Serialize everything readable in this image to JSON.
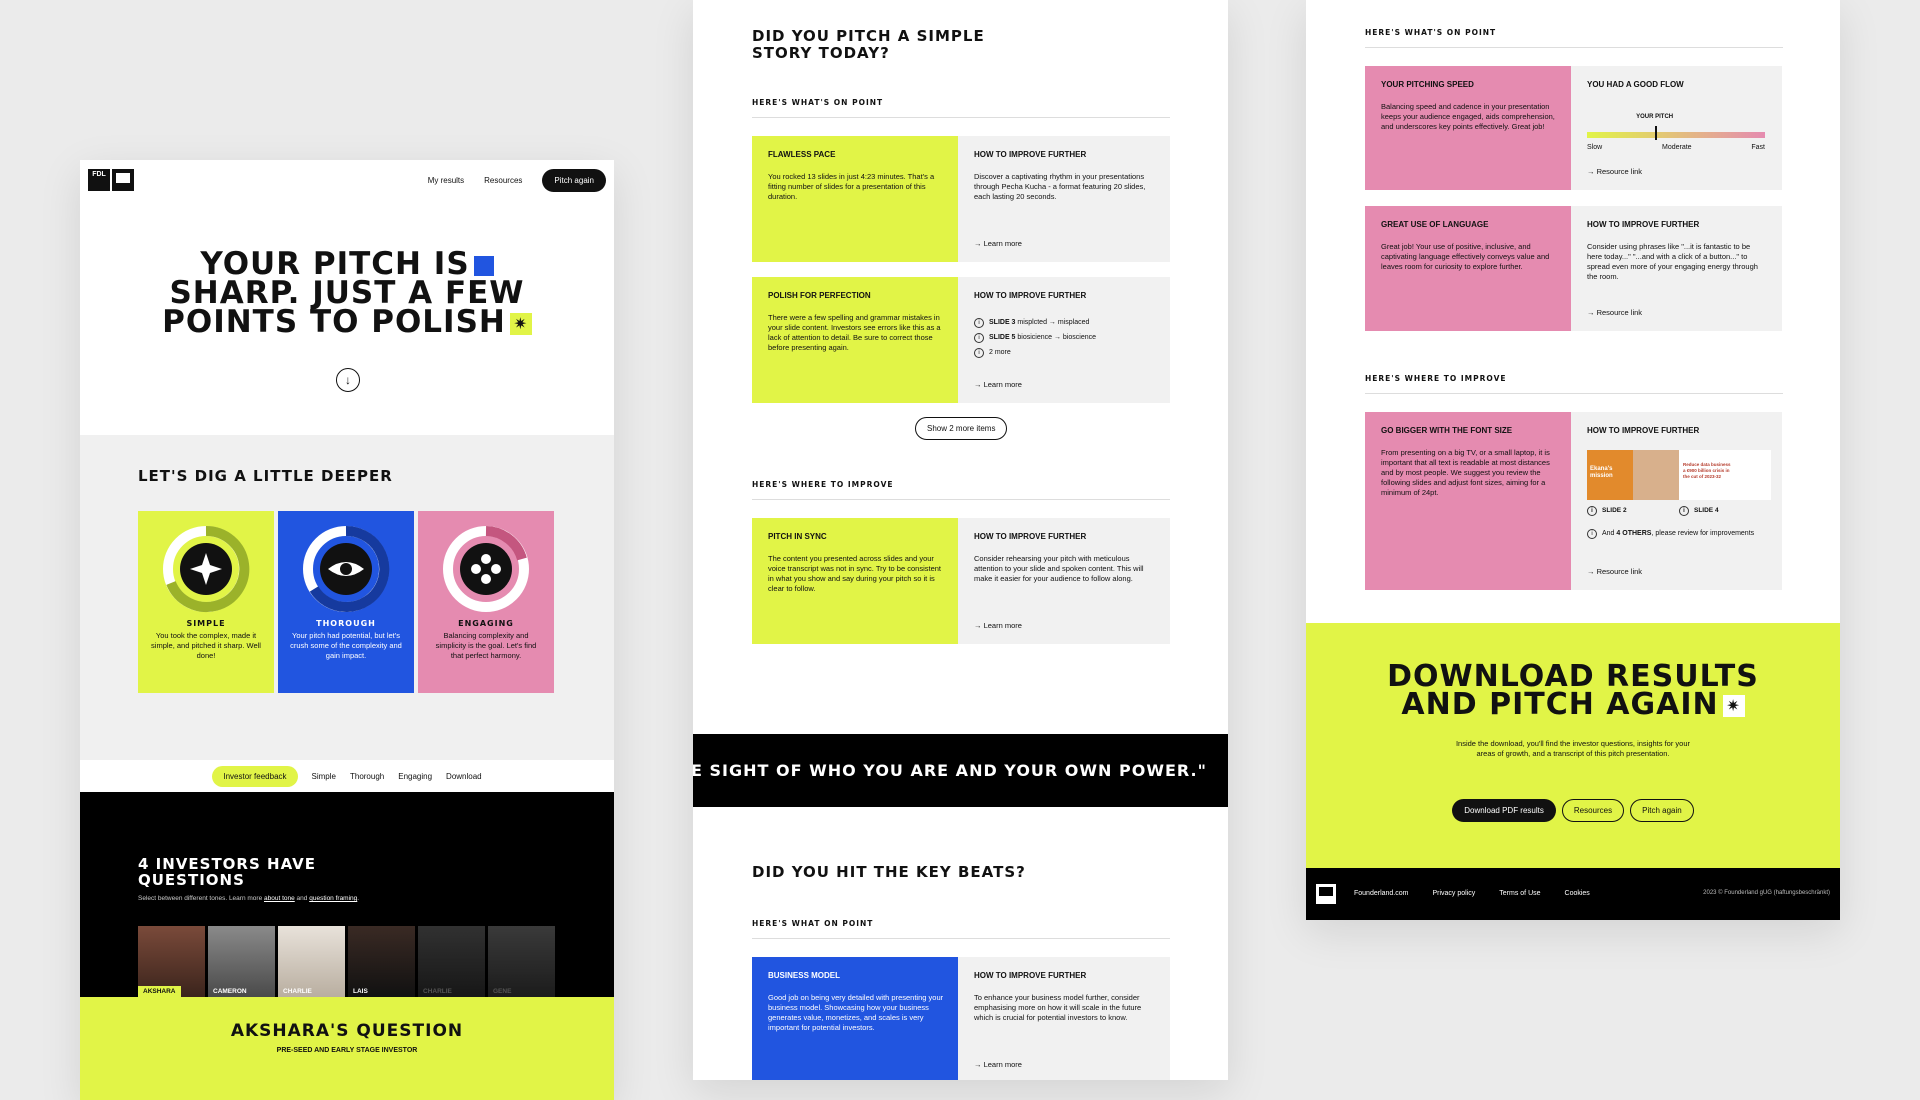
{
  "colors": {
    "lime": "#e1f447",
    "blue": "#2155e0",
    "pink": "#e58bb0",
    "black": "#000000",
    "bg": "#ebebeb"
  },
  "panel1": {
    "logo_text": "FDL",
    "nav": {
      "my_results": "My results",
      "resources": "Resources",
      "pitch_again": "Pitch again"
    },
    "hero": {
      "line1": "YOUR PITCH IS",
      "line2": "SHARP. JUST A FEW",
      "line3": "POINTS TO POLISH"
    },
    "scroll_icon": "arrow-down-icon",
    "dig_title": "LET'S DIG A LITTLE DEEPER",
    "cards": [
      {
        "title": "SIMPLE",
        "desc": "You took the complex, made it simple, and pitched it sharp. Well done!"
      },
      {
        "title": "THOROUGH",
        "desc": "Your pitch had potential, but let's crush some of the complexity and gain impact."
      },
      {
        "title": "ENGAGING",
        "desc": "Balancing complexity and simplicity is the goal. Let's find that perfect harmony."
      }
    ],
    "tabs": [
      "Investor feedback",
      "Simple",
      "Thorough",
      "Engaging",
      "Download"
    ],
    "investors_title_1": "4 INVESTORS HAVE",
    "investors_title_2": "QUESTIONS",
    "investors_sub_1": "Select between different tones. Learn more",
    "investors_sub_link1": "about tone",
    "investors_sub_2": "and",
    "investors_sub_link2": "question framing",
    "investors": [
      "AKSHARA",
      "CAMERON",
      "CHARLIE",
      "LAIS",
      "CHARLIE",
      "GENE"
    ],
    "question_title": "AKSHARA'S QUESTION",
    "question_sub": "PRE-SEED AND EARLY STAGE INVESTOR"
  },
  "panel2": {
    "title_1": "DID YOU PITCH A SIMPLE",
    "title_2": "STORY TODAY?",
    "on_point": "HERE'S WHAT'S ON POINT",
    "blocks": [
      {
        "title": "FLAWLESS PACE",
        "desc": "You rocked 13 slides in just 4:23 minutes. That's a fitting number of slides for a presentation of this duration.",
        "r_title": "HOW TO IMPROVE FURTHER",
        "r_desc": "Discover a captivating rhythm in your presentations through Pecha Kucha - a format featuring 20 slides, each lasting 20 seconds.",
        "link": "Learn more"
      },
      {
        "title": "POLISH FOR PERFECTION",
        "desc": "There were a few spelling and grammar mistakes in your slide content. Investors see errors like this as a lack of attention to detail. Be sure to correct those before presenting again.",
        "r_title": "HOW TO IMPROVE FURTHER",
        "link": "Learn more"
      }
    ],
    "slide_fixes": [
      {
        "slide": "SLIDE 3",
        "text": "misplcted → misplaced"
      },
      {
        "slide": "SLIDE 5",
        "text": "biosicience → bioscience"
      },
      {
        "slide": "",
        "text": "2 more"
      }
    ],
    "show_more": "Show 2 more items",
    "improve_label": "HERE'S WHERE TO IMPROVE",
    "sync": {
      "title": "PITCH IN SYNC",
      "desc": "The content you presented across slides and your voice transcript was not in sync. Try to be consistent in what you show and say during your pitch so it is clear to follow.",
      "r_title": "HOW TO IMPROVE FURTHER",
      "r_desc": "Consider rehearsing your pitch with meticulous attention to your slide and spoken content. This will make it easier for your audience to follow along.",
      "link": "Learn more"
    },
    "quote": "E SIGHT OF WHO YOU ARE AND YOUR OWN POWER.\"",
    "beats_title": "DID YOU HIT THE KEY BEATS?",
    "beats_on_point": "HERE'S WHAT ON POINT",
    "business": {
      "title": "BUSINESS MODEL",
      "desc": "Good job on being very detailed with presenting your business model. Showcasing how your business generates value, monetizes, and scales is very important for potential investors.",
      "r_title": "HOW TO IMPROVE FURTHER",
      "r_desc": "To enhance your business model further, consider emphasising more on how it will scale in the future which is crucial for potential investors to know.",
      "link": "Learn more"
    }
  },
  "panel3": {
    "on_point": "HERE'S WHAT'S ON POINT",
    "speed": {
      "title": "YOUR PITCHING SPEED",
      "desc": "Balancing speed and cadence in your presentation keeps your audience engaged, aids comprehension, and underscores key points effectively. Great job!",
      "r_title": "YOU HAD A GOOD FLOW",
      "meter_label": "YOUR PITCH",
      "slow": "Slow",
      "moderate": "Moderate",
      "fast": "Fast",
      "link": "Resource link",
      "pitch_position": 0.38
    },
    "language": {
      "title": "GREAT USE OF LANGUAGE",
      "desc": "Great job! Your use of positive, inclusive, and captivating language effectively conveys value and leaves room for curiosity to explore further.",
      "r_title": "HOW TO IMPROVE FURTHER",
      "r_desc": "Consider using phrases like \"...it is fantastic to be here today...\" \"...and with a click of a button...\" to spread even more of your engaging energy through the room.",
      "link": "Resource link"
    },
    "improve_label": "HERE'S WHERE TO IMPROVE",
    "font": {
      "title": "GO BIGGER WITH THE FONT SIZE",
      "desc": "From presenting on a big TV, or a small laptop, it is important that all text is readable at most distances and by most people. We suggest you review the following slides and adjust font sizes, aiming for a minimum of 24pt.",
      "r_title": "HOW TO IMPROVE FURTHER",
      "slide_a": "SLIDE 2",
      "slide_b": "SLIDE 4",
      "thumb_a_text": "Ekana's mission",
      "thumb_b_text": "Reduce data business a €900 billion crisis in the cut of 2023-32",
      "others_pre": "And",
      "others_bold": "4 OTHERS",
      "others_post": ", please review for improvements",
      "link": "Resource link"
    },
    "download_title_1": "DOWNLOAD RESULTS",
    "download_title_2": "AND PITCH AGAIN",
    "download_desc": "Inside the download, you'll find the investor questions, insights for your areas of growth, and a transcript of this pitch presentation.",
    "buttons": {
      "download": "Download PDF results",
      "resources": "Resources",
      "pitch_again": "Pitch again"
    },
    "footer": {
      "links": [
        "Founderland.com",
        "Privacy policy",
        "Terms of Use",
        "Cookies"
      ],
      "copy": "2023 © Founderland gUG (haftungsbeschränkt)"
    }
  }
}
